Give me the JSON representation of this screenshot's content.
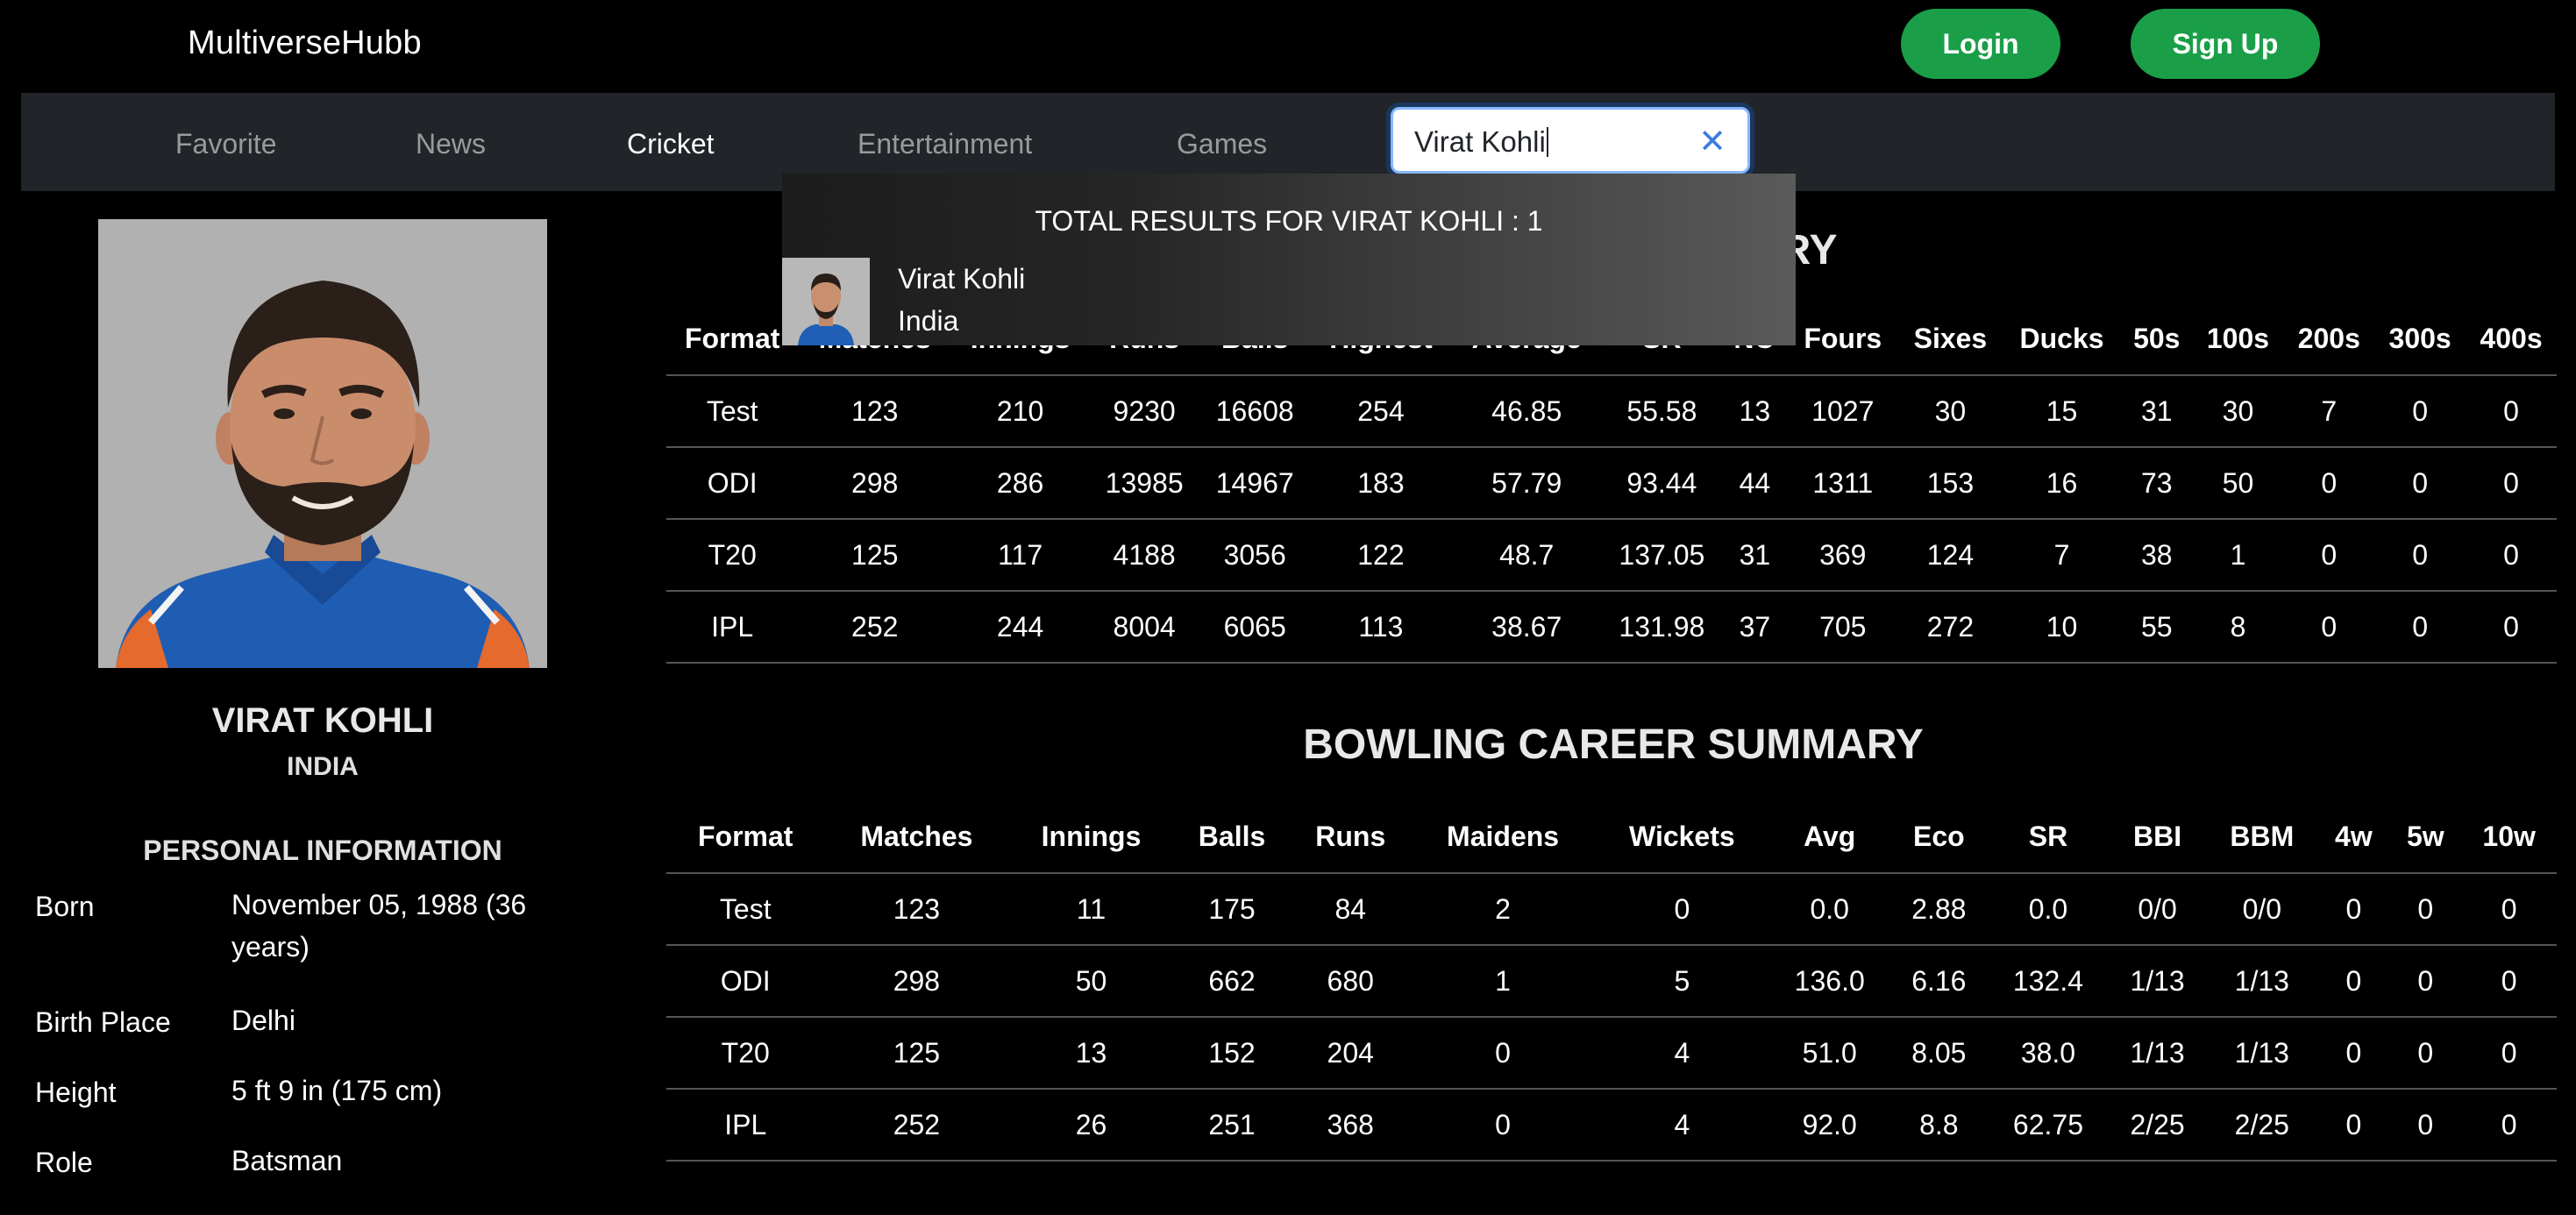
{
  "brand": "MultiverseHubb",
  "auth": {
    "login_label": "Login",
    "signup_label": "Sign Up"
  },
  "nav": {
    "items": [
      {
        "label": "Favorite",
        "active": false
      },
      {
        "label": "News",
        "active": false
      },
      {
        "label": "Cricket",
        "active": true
      },
      {
        "label": "Entertainment",
        "active": false
      },
      {
        "label": "Games",
        "active": false
      }
    ]
  },
  "search": {
    "value": "Virat Kohli",
    "clear_icon": "close-icon",
    "dropdown": {
      "title": "TOTAL RESULTS FOR VIRAT KOHLI : 1",
      "results": [
        {
          "name": "Virat Kohli",
          "country": "India"
        }
      ]
    }
  },
  "profile": {
    "name": "VIRAT KOHLI",
    "country": "INDIA",
    "personal_heading": "PERSONAL INFORMATION",
    "info": [
      {
        "label": "Born",
        "value": "November 05, 1988 (36 years)"
      },
      {
        "label": "Birth Place",
        "value": "Delhi"
      },
      {
        "label": "Height",
        "value": "5 ft 9 in (175 cm)"
      },
      {
        "label": "Role",
        "value": "Batsman"
      }
    ]
  },
  "batting": {
    "title_visible": "MARY",
    "columns": [
      "Format",
      "Matches",
      "Innings",
      "Runs",
      "Balls",
      "Highest",
      "Average",
      "SR",
      "NO",
      "Fours",
      "Sixes",
      "Ducks",
      "50s",
      "100s",
      "200s",
      "300s",
      "400s"
    ],
    "rows": [
      [
        "Test",
        "123",
        "210",
        "9230",
        "16608",
        "254",
        "46.85",
        "55.58",
        "13",
        "1027",
        "30",
        "15",
        "31",
        "30",
        "7",
        "0",
        "0"
      ],
      [
        "ODI",
        "298",
        "286",
        "13985",
        "14967",
        "183",
        "57.79",
        "93.44",
        "44",
        "1311",
        "153",
        "16",
        "73",
        "50",
        "0",
        "0",
        "0"
      ],
      [
        "T20",
        "125",
        "117",
        "4188",
        "3056",
        "122",
        "48.7",
        "137.05",
        "31",
        "369",
        "124",
        "7",
        "38",
        "1",
        "0",
        "0",
        "0"
      ],
      [
        "IPL",
        "252",
        "244",
        "8004",
        "6065",
        "113",
        "38.67",
        "131.98",
        "37",
        "705",
        "272",
        "10",
        "55",
        "8",
        "0",
        "0",
        "0"
      ]
    ]
  },
  "bowling": {
    "title": "BOWLING CAREER SUMMARY",
    "columns": [
      "Format",
      "Matches",
      "Innings",
      "Balls",
      "Runs",
      "Maidens",
      "Wickets",
      "Avg",
      "Eco",
      "SR",
      "BBI",
      "BBM",
      "4w",
      "5w",
      "10w"
    ],
    "rows": [
      [
        "Test",
        "123",
        "11",
        "175",
        "84",
        "2",
        "0",
        "0.0",
        "2.88",
        "0.0",
        "0/0",
        "0/0",
        "0",
        "0",
        "0"
      ],
      [
        "ODI",
        "298",
        "50",
        "662",
        "680",
        "1",
        "5",
        "136.0",
        "6.16",
        "132.4",
        "1/13",
        "1/13",
        "0",
        "0",
        "0"
      ],
      [
        "T20",
        "125",
        "13",
        "152",
        "204",
        "0",
        "4",
        "51.0",
        "8.05",
        "38.0",
        "1/13",
        "1/13",
        "0",
        "0",
        "0"
      ],
      [
        "IPL",
        "252",
        "26",
        "251",
        "368",
        "0",
        "4",
        "92.0",
        "8.8",
        "62.75",
        "2/25",
        "2/25",
        "0",
        "0",
        "0"
      ]
    ]
  }
}
